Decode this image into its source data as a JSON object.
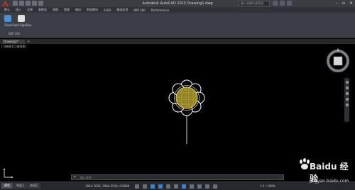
{
  "titlebar": {
    "title": "Autodesk AutoCAD 2015   Drawing1.dwg",
    "search_placeholder": "键入关键字或短语"
  },
  "menubar": {
    "items": [
      "默认",
      "插入",
      "注释",
      "参数化",
      "视图",
      "管理",
      "输出",
      "附加模块",
      "A360",
      "精选应用",
      "BIM 360",
      "Performance"
    ]
  },
  "ribbon": {
    "buttons": [
      {
        "label": "Glue",
        "color": "#4a90d9"
      },
      {
        "label": "Clash Pipeline",
        "color": "#e0e0e0"
      }
    ],
    "panel_label": "BIM 360"
  },
  "tabs": {
    "doc_tab": "Drawing1*"
  },
  "viewport": {
    "label": "[-][俯视][二维线框]"
  },
  "command": {
    "placeholder": "键入命令"
  },
  "layout_tabs": [
    "模型",
    "布局1",
    "布局2"
  ],
  "status": {
    "coords": "1924.7630, 1904.3520, 0.0000",
    "mode": "模型",
    "scale": "1:1 / 100%"
  },
  "colors": {
    "flower": "#c9b13a",
    "outline": "#ffffff",
    "stem": "#d6d6d6",
    "accent": "#3a7fd0"
  },
  "watermark": {
    "brand": "Baidu 经验",
    "url": "jingyan.baidu.com"
  }
}
